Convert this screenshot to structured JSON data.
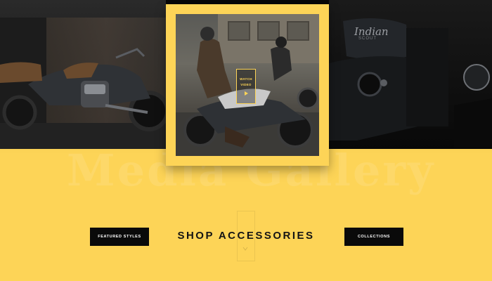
{
  "gallery": {
    "watermark": "Media Gallery",
    "feature": {
      "video_button": {
        "line1": "WATCH",
        "line2": "VIDEO"
      }
    },
    "right_panel_brand": {
      "line1": "Indian",
      "line2": "SCOUT"
    }
  },
  "nav": {
    "heading": "SHOP ACCESSORIES",
    "featured_styles": "FEATURED STYLES",
    "collections": "COLLECTIONS"
  },
  "colors": {
    "accent_yellow": "#fdd457",
    "button_black": "#0a0a0a",
    "heading_text": "#141414"
  },
  "icons": [
    "play-icon",
    "down-arrow-icon"
  ]
}
